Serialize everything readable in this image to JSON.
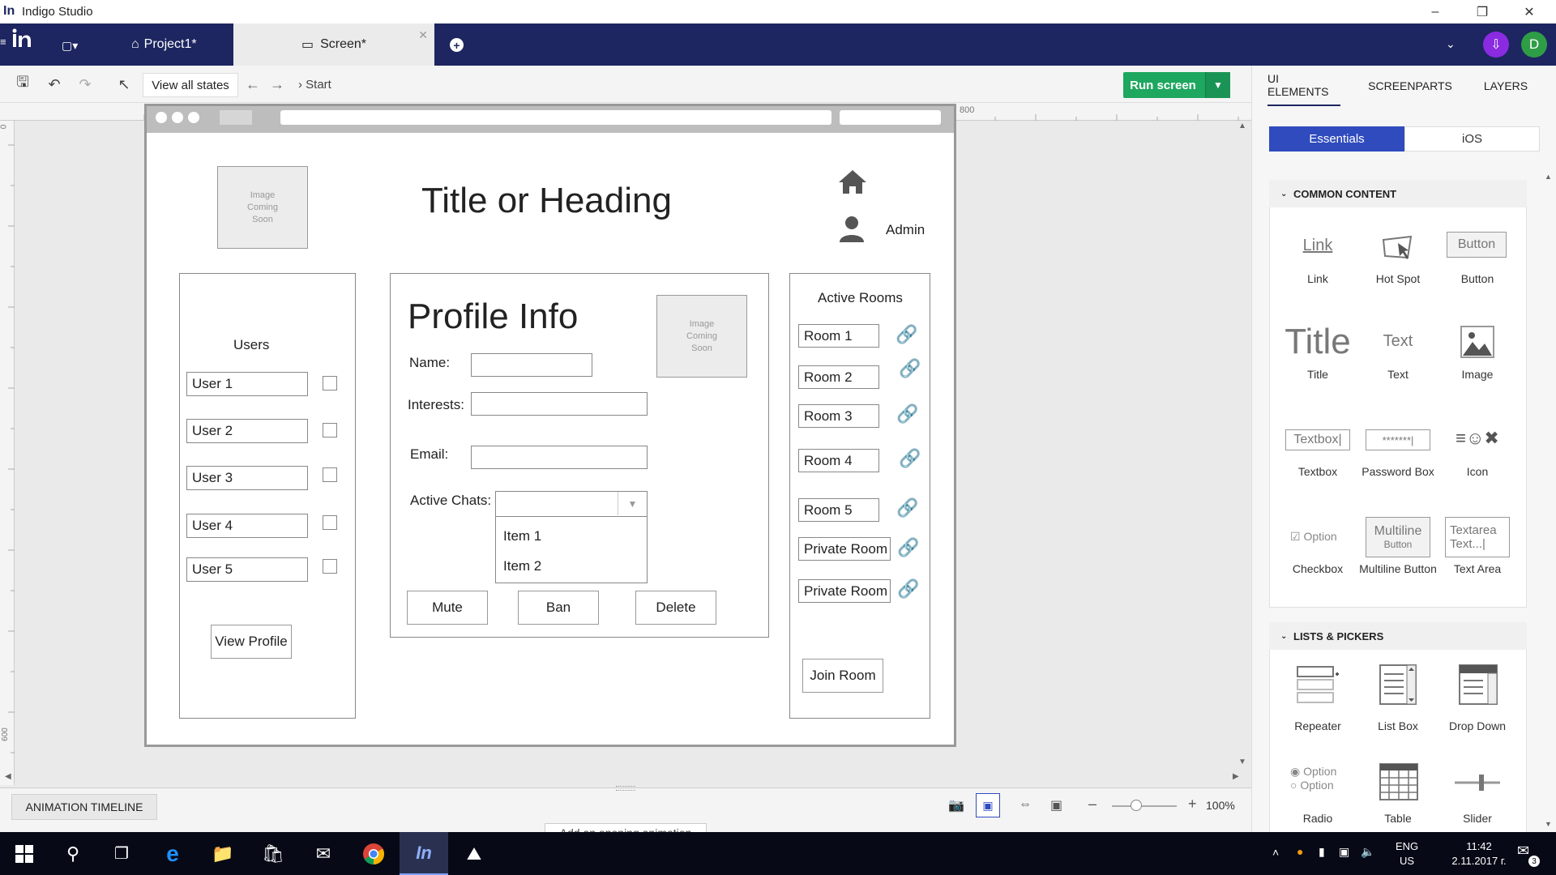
{
  "app": {
    "title": "Indigo Studio",
    "logo": "In"
  },
  "tabs": {
    "project": "Project1*",
    "screen": "Screen*"
  },
  "toolbar": {
    "view_all": "View all states",
    "breadcrumb": "Start",
    "run": "Run screen"
  },
  "user_initial": "D",
  "ruler": {
    "h_marks": [
      "0",
      "800"
    ],
    "v_marks": [
      "0",
      "600"
    ]
  },
  "canvas": {
    "title": "Title or Heading",
    "admin": "Admin",
    "image_placeholder": "Image\nComing\nSoon",
    "users": {
      "heading": "Users",
      "items": [
        "User 1",
        "User 2",
        "User 3",
        "User 4",
        "User 5"
      ],
      "view_profile": "View Profile"
    },
    "profile": {
      "heading": "Profile Info",
      "name_label": "Name:",
      "interests_label": "Interests:",
      "email_label": "Email:",
      "chats_label": "Active Chats:",
      "list_items": [
        "Item 1",
        "Item 2"
      ],
      "buttons": [
        "Mute",
        "Ban",
        "Delete"
      ]
    },
    "rooms": {
      "heading": "Active Rooms",
      "items": [
        "Room 1",
        "Room 2",
        "Room 3",
        "Room 4",
        "Room 5",
        "Private Room",
        "Private Room"
      ],
      "join": "Join Room"
    }
  },
  "panel": {
    "tabs": [
      "UI ELEMENTS",
      "SCREENPARTS",
      "LAYERS"
    ],
    "segments": [
      "Essentials",
      "iOS"
    ],
    "common": {
      "title": "COMMON CONTENT",
      "items": [
        {
          "label": "Link",
          "preview": "Link"
        },
        {
          "label": "Hot Spot"
        },
        {
          "label": "Button",
          "preview": "Button"
        },
        {
          "label": "Title",
          "preview": "Title"
        },
        {
          "label": "Text",
          "preview": "Text"
        },
        {
          "label": "Image"
        },
        {
          "label": "Textbox",
          "preview": "Textbox|"
        },
        {
          "label": "Password Box",
          "preview": "*******|"
        },
        {
          "label": "Icon"
        },
        {
          "label": "Checkbox",
          "preview": "Option"
        },
        {
          "label": "Multiline Button",
          "preview": "Multiline",
          "preview2": "Button"
        },
        {
          "label": "Text Area",
          "preview": "Textarea",
          "preview2": "Text...|"
        }
      ]
    },
    "lists": {
      "title": "LISTS & PICKERS",
      "items": [
        {
          "label": "Repeater"
        },
        {
          "label": "List Box"
        },
        {
          "label": "Drop Down"
        },
        {
          "label": "Radio",
          "preview": "Option",
          "preview2": "Option"
        },
        {
          "label": "Table"
        },
        {
          "label": "Slider"
        }
      ]
    }
  },
  "bottom": {
    "timeline": "ANIMATION TIMELINE",
    "zoom": "100%",
    "animation_hint": "Add an opening animation"
  },
  "taskbar": {
    "lang1": "ENG",
    "lang2": "US",
    "time": "11:42",
    "date": "2.11.2017 г.",
    "notif": "3"
  },
  "colors": {
    "navy": "#1d2660",
    "run_green": "#1ea75f",
    "avatar_green": "#2f9d46",
    "download_purple": "#8a2be2"
  }
}
